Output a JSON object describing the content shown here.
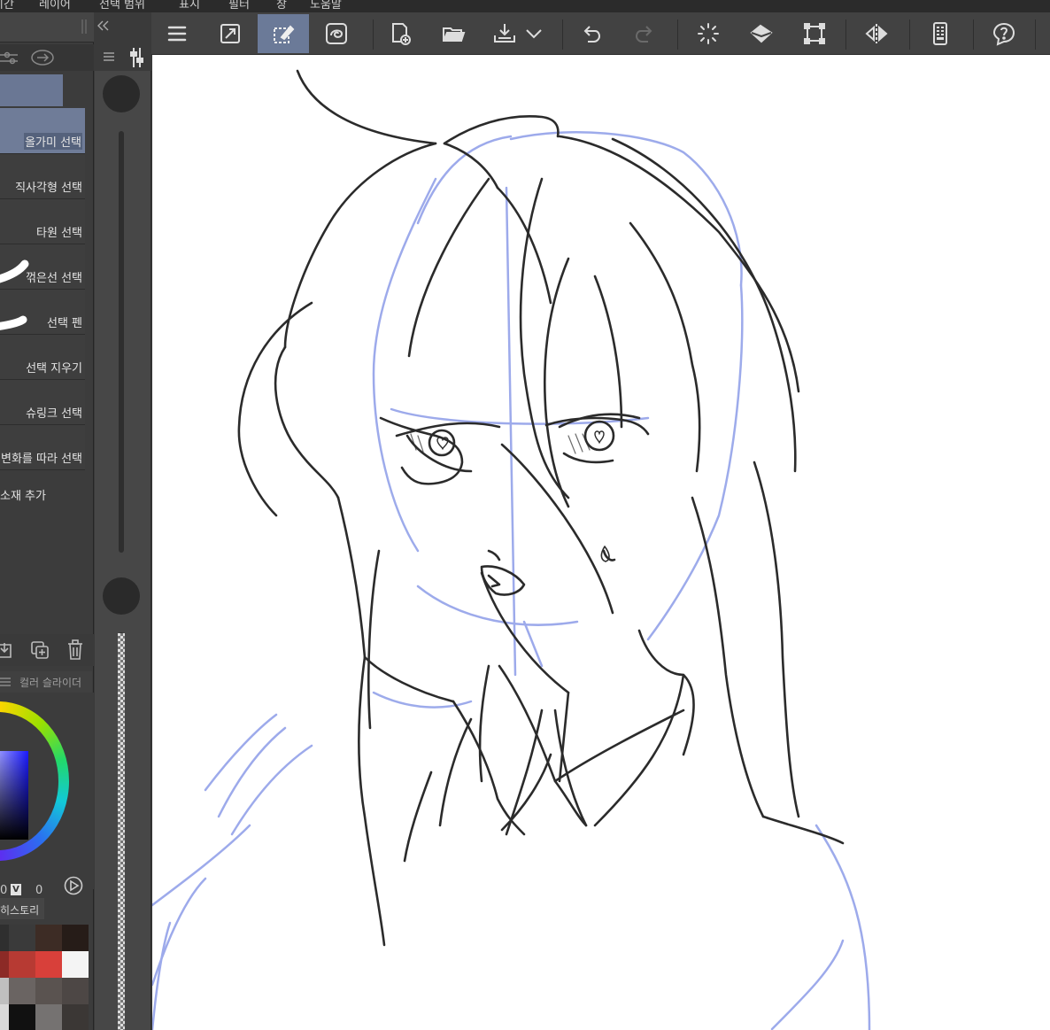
{
  "menubar": {
    "items": [
      "시간",
      "레이어",
      "선택 범위",
      "표시",
      "필터",
      "창",
      "도움말"
    ]
  },
  "toolbar": {
    "buttons": [
      {
        "name": "menu-icon"
      },
      {
        "name": "fit-icon"
      },
      {
        "name": "selection-tool-icon",
        "active": true
      },
      {
        "name": "lasso-icon"
      },
      {
        "name": "new-file-icon"
      },
      {
        "name": "open-folder-icon"
      },
      {
        "name": "save-icon"
      },
      {
        "name": "chevron-down-icon"
      },
      {
        "name": "undo-icon"
      },
      {
        "name": "redo-icon"
      },
      {
        "name": "loading-icon"
      },
      {
        "name": "fill-icon"
      },
      {
        "name": "transform-icon"
      },
      {
        "name": "flip-icon"
      },
      {
        "name": "device-icon"
      },
      {
        "name": "help-icon"
      }
    ]
  },
  "subtools": [
    {
      "label": "올가미 선택",
      "selected": true
    },
    {
      "label": "직사각형 선택"
    },
    {
      "label": "타원 선택"
    },
    {
      "label": "꺾은선 선택"
    },
    {
      "label": "선택 펜"
    },
    {
      "label": "선택 지우기"
    },
    {
      "label": "슈링크 선택"
    },
    {
      "label": "변화를 따라 선택"
    },
    {
      "label": "소재 추가"
    }
  ],
  "color_panel": {
    "tab_label": "컬러 슬라이더",
    "v_label": "V",
    "v_value": "0",
    "left_value": "0"
  },
  "history": {
    "tab_label": "히스토리"
  },
  "colors": {
    "accent": "#6b7a98",
    "sketch_line": "#2b2b2b",
    "guide_blue": "#8c9ce8",
    "canvas": "#ffffff"
  },
  "swatches": [
    "#2f2f2f",
    "#3a3a3a",
    "#3d2c25",
    "#261c18",
    "#8c2a26",
    "#b73a33",
    "#d8403a",
    "#f4f4f4",
    "#bfbfbf",
    "#6a6462",
    "#5a5350",
    "#4d4745",
    "#d9d9d9",
    "#111111",
    "#757271",
    "#3b3735"
  ]
}
